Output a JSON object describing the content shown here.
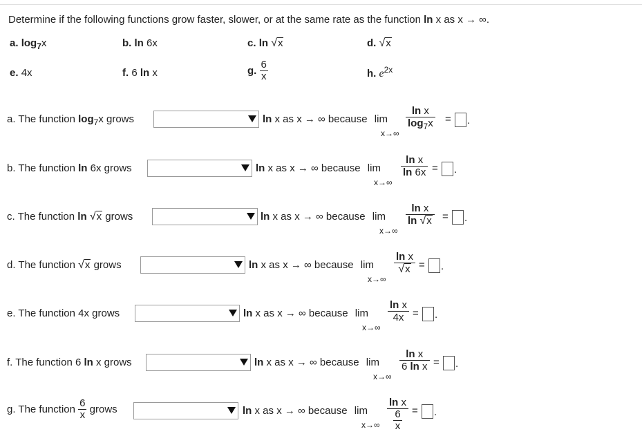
{
  "instruction": {
    "prefix": "Determine if the following functions grow faster, slower, or at the same rate as the function",
    "func": "ln",
    "var": "x",
    "suffix": "as x → ∞."
  },
  "options": {
    "a_label": "a.",
    "a_log": "log",
    "a_base": "7",
    "a_var": "x",
    "b_label": "b.",
    "b_expr": "ln",
    "b_arg": "6x",
    "c_label": "c.",
    "c_expr": "ln",
    "c_radicand": "x",
    "d_label": "d.",
    "d_radicand": "x",
    "e_label": "e.",
    "e_expr": "4x",
    "f_label": "f.",
    "f_coef": "6",
    "f_ln": "ln",
    "f_var": "x",
    "g_label": "g.",
    "g_num": "6",
    "g_den": "x",
    "h_label": "h.",
    "h_base": "e",
    "h_exp": "2x"
  },
  "rows": {
    "a": {
      "lead": "a. The function",
      "fn_b": "log",
      "fn_sub": "7",
      "fn_tail": "x",
      "grows": "grows"
    },
    "b": {
      "lead": "b. The function",
      "fn_b": "ln",
      "fn_tail": "6x",
      "grows": "grows"
    },
    "c": {
      "lead": "c. The function",
      "fn_b": "ln",
      "radicand": "x",
      "grows": "grows"
    },
    "d": {
      "lead": "d. The function",
      "radicand": "x",
      "grows": "grows"
    },
    "e": {
      "lead": "e. The function 4x grows"
    },
    "f": {
      "lead": "f. The function 6",
      "fn_b": "ln",
      "fn_tail": "x grows"
    },
    "g": {
      "lead": "g. The function",
      "num": "6",
      "den": "x",
      "grows": "grows"
    }
  },
  "common": {
    "ln": "ln",
    "asx": "x as x → ∞ because",
    "lim": "lim",
    "under": "x→∞",
    "eq": "=",
    "numer_ln": "ln",
    "numer_x": "x",
    "period": "."
  },
  "denoms": {
    "a": {
      "b": "log",
      "sub": "7",
      "tail": "x"
    },
    "b": {
      "b": "ln",
      "tail": "6x"
    },
    "c": {
      "b": "ln",
      "radicand": "x"
    },
    "d": {
      "radicand": "x"
    },
    "e": {
      "text": "4x"
    },
    "f": {
      "coef": "6",
      "b": "ln",
      "tail": "x"
    },
    "g": {
      "num": "6",
      "den": "x"
    }
  }
}
